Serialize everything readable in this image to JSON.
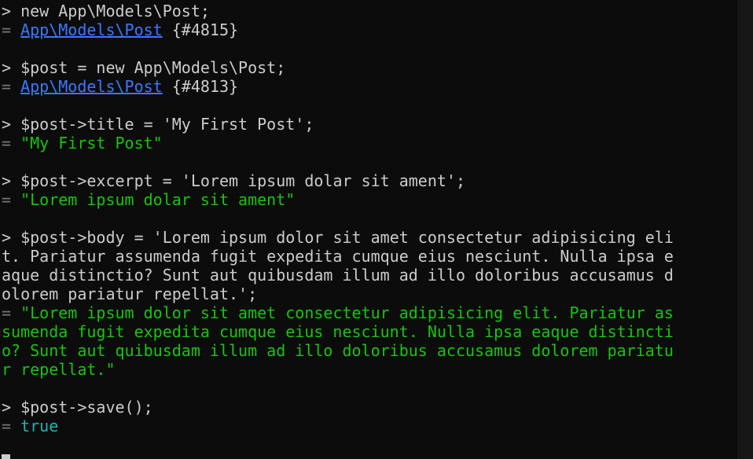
{
  "prompt_symbol": ">",
  "result_symbol": "=",
  "colors": {
    "background": "#0c0c0c",
    "text": "#cccccc",
    "link": "#3b78ff",
    "string": "#16c60c",
    "boolean": "#1fb3b3",
    "result_marker": "#767676"
  },
  "entries": [
    {
      "input": " new App\\Models\\Post;",
      "result": {
        "class": "App\\Models\\Post",
        "id": " {#4815}"
      }
    },
    {
      "input": " $post = new App\\Models\\Post;",
      "result": {
        "class": "App\\Models\\Post",
        "id": " {#4813}"
      }
    },
    {
      "input": " $post->title = 'My First Post';",
      "result": {
        "string": "\"My First Post\""
      }
    },
    {
      "input": " $post->excerpt = 'Lorem ipsum dolar sit ament';",
      "result": {
        "string": "\"Lorem ipsum dolar sit ament\""
      }
    },
    {
      "input_lines": [
        " $post->body = 'Lorem ipsum dolor sit amet consectetur adipisicing eli",
        "t. Pariatur assumenda fugit expedita cumque eius nesciunt. Nulla ipsa e",
        "aque distinctio? Sunt aut quibusdam illum ad illo doloribus accusamus d",
        "olorem pariatur repellat.';"
      ],
      "result_lines": [
        "\"Lorem ipsum dolor sit amet consectetur adipisicing elit. Pariatur as",
        "sumenda fugit expedita cumque eius nesciunt. Nulla ipsa eaque distincti",
        "o? Sunt aut quibusdam illum ad illo doloribus accusamus dolorem pariatu",
        "r repellat.\""
      ]
    },
    {
      "input": " $post->save();",
      "result": {
        "boolean": "true"
      }
    }
  ]
}
